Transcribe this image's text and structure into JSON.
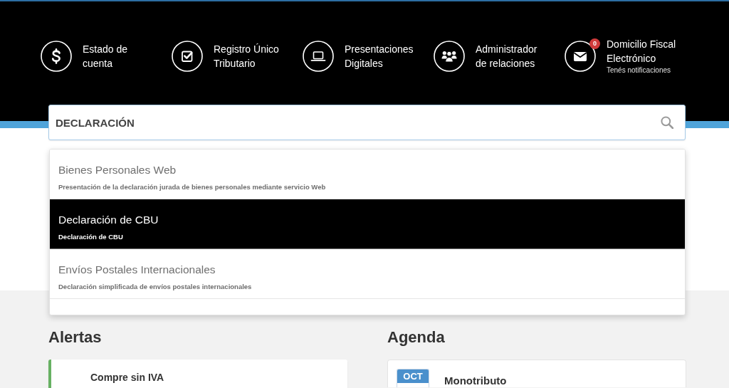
{
  "header_nav": [
    {
      "label": "Estado de cuenta"
    },
    {
      "label": "Registro Único Tributario"
    },
    {
      "label": "Presentaciones Digitales"
    },
    {
      "label": "Administrador de relaciones"
    },
    {
      "label": "Domicilio Fiscal Electrónico",
      "badge": "0",
      "subtitle": "Tenés notificaciones"
    }
  ],
  "search": {
    "value": "DECLARACIÓN"
  },
  "suggestions": [
    {
      "title": "Bienes Personales Web",
      "description": "Presentación de la declaración jurada de bienes personales mediante servicio Web",
      "selected": false
    },
    {
      "title": "Declaración de CBU",
      "description": "Declaración de CBU",
      "selected": true
    },
    {
      "title": "Envíos Postales Internacionales",
      "description": "Declaración simplificada de envíos postales internacionales",
      "selected": false
    }
  ],
  "alerts": {
    "title": "Alertas",
    "items": [
      {
        "title": "Compre sin IVA"
      }
    ]
  },
  "agenda": {
    "title": "Agenda",
    "items": [
      {
        "month": "OCT",
        "title": "Monotributo"
      }
    ]
  }
}
